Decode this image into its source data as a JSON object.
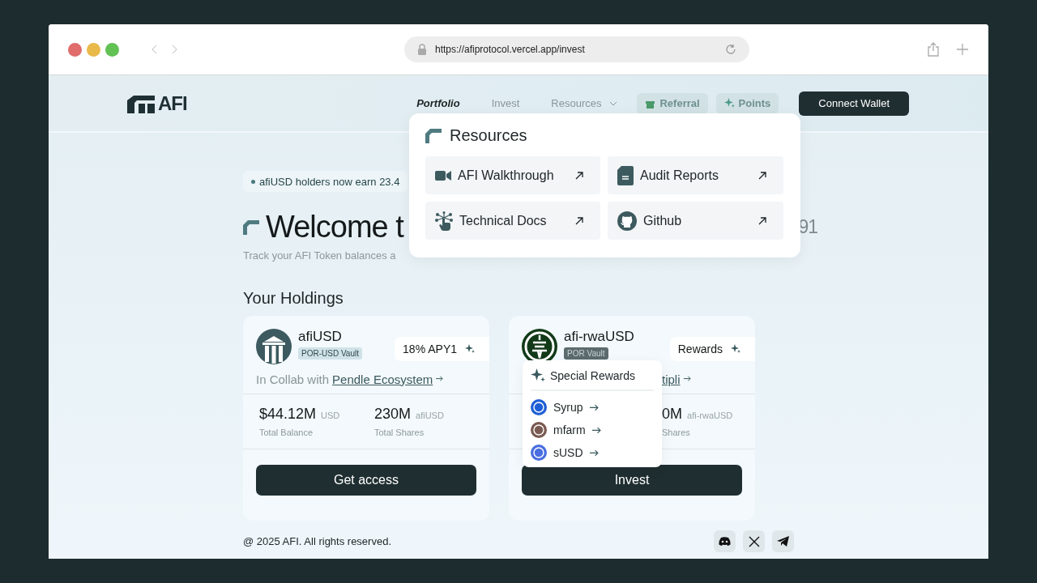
{
  "browser": {
    "url": "https://afiprotocol.vercel.app/invest"
  },
  "nav": {
    "logo": "AFI",
    "links": [
      {
        "label": "Portfolio",
        "selected": true,
        "kind": "link"
      },
      {
        "label": "Invest",
        "selected": false,
        "kind": "link"
      },
      {
        "label": "Resources",
        "selected": false,
        "kind": "menu",
        "expanded": true
      }
    ],
    "chips": [
      {
        "label": "Referral",
        "kind": "gift"
      },
      {
        "label": "Points",
        "kind": "sparkle"
      }
    ],
    "connect": "Connect Wallet"
  },
  "resources_menu": {
    "title": "Resources",
    "items": [
      {
        "label": "AFI Walkthrough",
        "kind": "video"
      },
      {
        "label": "Audit Reports",
        "kind": "document"
      },
      {
        "label": "Technical Docs",
        "kind": "touch"
      },
      {
        "label": "Github",
        "kind": "github"
      }
    ]
  },
  "announcement": "afiUSD holders now earn 23.4",
  "hero": {
    "title": "Welcome t",
    "title_tail": "91",
    "subtitle": "Track your AFI Token balances a"
  },
  "holdings": {
    "title": "Your Holdings",
    "cards": [
      {
        "name": "afiUSD",
        "kind": "pillars",
        "badge": "POR-USD Vault",
        "chip": "18% APY1",
        "collab_prefix": "In Collab with",
        "collab_link": "Pendle Ecosystem",
        "rewards_open": false,
        "stats": [
          {
            "value": "$44.12M",
            "unit": "USD",
            "label": "Total Balance"
          },
          {
            "value": "230M",
            "unit": "afiUSD",
            "label": "Total Shares"
          }
        ],
        "button": "Get access"
      },
      {
        "name": "afi-rwaUSD",
        "kind": "coin",
        "badge": "POR Vault",
        "chip": "Rewards",
        "collab_link": "tipli",
        "rewards_open": true,
        "stats": [
          {
            "value": "0M",
            "unit": "afi-rwaUSD",
            "label": "Shares"
          }
        ],
        "button": "Invest",
        "rewards": {
          "title": "Special Rewards",
          "items": [
            {
              "label": "Syrup",
              "color": "#1f5fd6"
            },
            {
              "label": "mfarm",
              "color": "#7a5a52"
            },
            {
              "label": "sUSD",
              "color": "#4a6ee0"
            }
          ]
        }
      }
    ]
  },
  "footer": {
    "copyright": "@ 2025 AFI. All rights reserved.",
    "socials": [
      {
        "kind": "discord"
      },
      {
        "kind": "x"
      },
      {
        "kind": "telegram"
      }
    ]
  }
}
